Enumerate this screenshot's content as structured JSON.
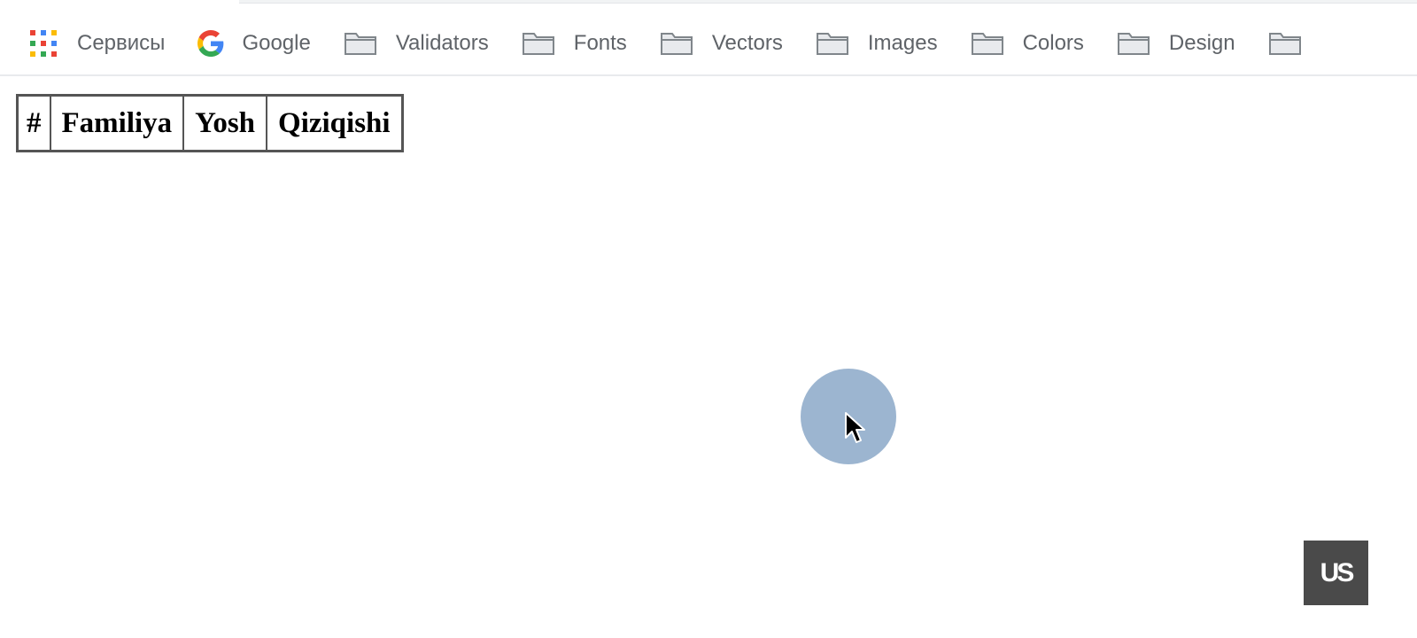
{
  "bookmarks_bar": {
    "items": [
      {
        "label": "Сервисы",
        "icon": "apps-grid-icon"
      },
      {
        "label": "Google",
        "icon": "google-icon"
      },
      {
        "label": "Validators",
        "icon": "folder-icon"
      },
      {
        "label": "Fonts",
        "icon": "folder-icon"
      },
      {
        "label": "Vectors",
        "icon": "folder-icon"
      },
      {
        "label": "Images",
        "icon": "folder-icon"
      },
      {
        "label": "Colors",
        "icon": "folder-icon"
      },
      {
        "label": "Design",
        "icon": "folder-icon"
      }
    ]
  },
  "table": {
    "headers": [
      "#",
      "Familiya",
      "Yosh",
      "Qiziqishi"
    ]
  },
  "watermark": {
    "text": "US"
  },
  "colors": {
    "bookmark_text": "#5f6368",
    "folder_icon": "#9aa0a6",
    "table_border": "#555555",
    "click_indicator": "#97b1cd",
    "logo_badge": "#4a4a4a"
  }
}
